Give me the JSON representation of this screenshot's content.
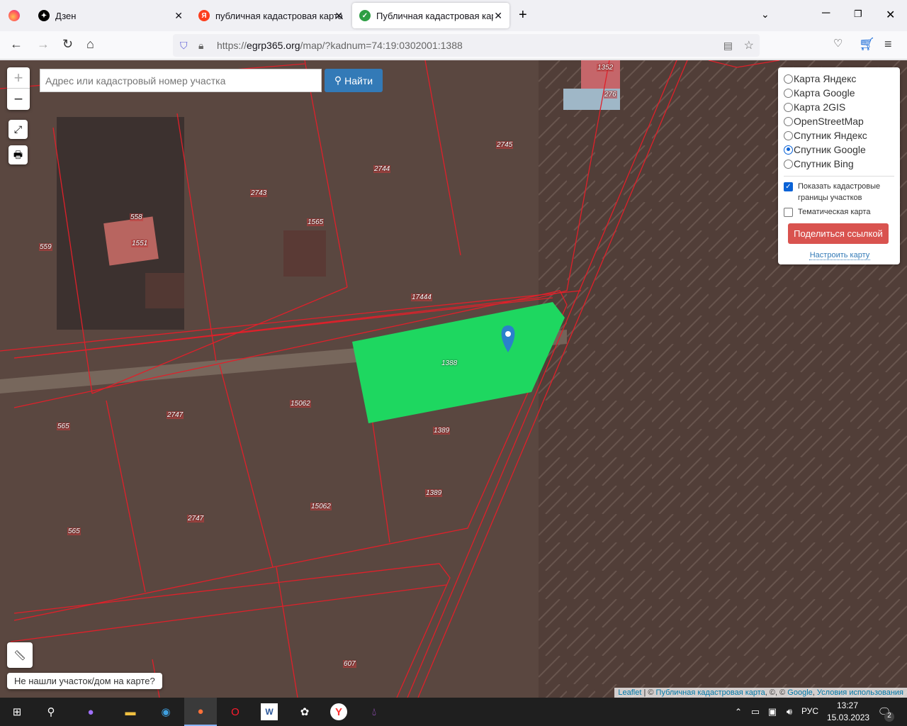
{
  "browser": {
    "tabs": [
      {
        "label": "Дзен"
      },
      {
        "label": "публичная кадастровая карта"
      },
      {
        "label": "Публичная кадастровая карта"
      }
    ],
    "url_prefix": "https://",
    "url_domain": "egrp365.org",
    "url_path": "/map/?kadnum=74:19:0302001:1388"
  },
  "map": {
    "search_placeholder": "Адрес или кадастровый номер участка",
    "find_label": "Найти",
    "zoom_in": "+",
    "zoom_out": "−",
    "layers": [
      "Карта Яндекс",
      "Карта Google",
      "Карта 2GIS",
      "OpenStreetMap",
      "Спутник Яндекс",
      "Спутник Google",
      "Спутник Bing"
    ],
    "selected_layer": "Спутник Google",
    "show_borders": "Показать кадастровые границы участков",
    "show_borders_checked": true,
    "thematic": "Тематическая карта",
    "thematic_checked": false,
    "share": "Поделиться ссылкой",
    "setup": "Настроить карту",
    "not_found": "Не нашли участок/дом на карте?",
    "attribution": {
      "leaflet": "Leaflet",
      "sep": " | © ",
      "pkk": "Публичная кадастровая карта",
      "mid": ", ©, © ",
      "google": "Google",
      "comma": ", ",
      "terms": "Условия использования"
    },
    "parcel_labels": [
      "559",
      "558",
      "1551",
      "2743",
      "1565",
      "2744",
      "2745",
      "1352",
      "276",
      "17444",
      "1388",
      "1389",
      "1389",
      "15062",
      "15062",
      "2747",
      "2747",
      "565",
      "565",
      "607"
    ],
    "highlight_color": "#1ed760"
  },
  "taskbar": {
    "lang": "РУС",
    "time": "13:27",
    "date": "15.03.2023",
    "notifications": "2"
  }
}
